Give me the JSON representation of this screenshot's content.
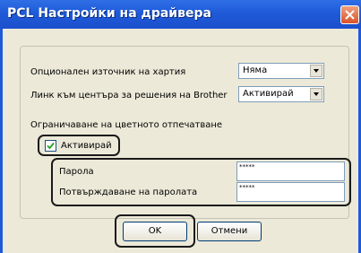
{
  "window": {
    "title": "PCL Настройки на драйвера"
  },
  "form": {
    "paper_source": {
      "label": "Опционален източник на хартия",
      "value": "Няма"
    },
    "solutions_center": {
      "label": "Линк към центъра за решения на Brother",
      "value": "Активирай"
    },
    "color_restriction": {
      "label": "Ограничаване на цветното отпечатване",
      "checkbox_label": "Активирай",
      "checked": true
    },
    "password": {
      "label": "Парола",
      "value": "*****"
    },
    "confirm_password": {
      "label": "Потвърждаване на паролата",
      "value": "*****"
    }
  },
  "buttons": {
    "ok": "OK",
    "cancel": "Отмени"
  }
}
